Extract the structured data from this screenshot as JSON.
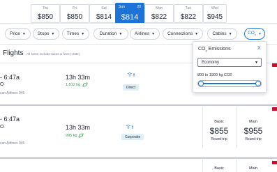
{
  "date_strip": {
    "cells": [
      {
        "dow": "Thu",
        "price": "$850"
      },
      {
        "dow": "Fri",
        "price": "$850"
      },
      {
        "dow": "Sat",
        "price": "$814"
      },
      {
        "dow": "Sun",
        "day": "20",
        "price": "$814",
        "active": true
      },
      {
        "dow": "Mon",
        "price": "$822"
      },
      {
        "dow": "Tue",
        "price": "$822"
      },
      {
        "dow": "Wed",
        "price": "$945"
      }
    ]
  },
  "filters": {
    "price": "Price",
    "stops": "Stops",
    "times": "Times",
    "duration": "Duration",
    "airlines": "Airlines",
    "connections": "Connections",
    "cabins": "Cabins",
    "co2": "CO",
    "co2_sub": "2"
  },
  "header": {
    "title": "Flights",
    "note": "All fares include taxes & fees (USD)"
  },
  "results": [
    {
      "time": "- 6:47a",
      "route": "O",
      "airline": "can Airlines 945",
      "duration": "13h 33m",
      "co2": "1,812 kg",
      "stop": "Direct"
    },
    {
      "time": "- 6:47a",
      "route": "O",
      "airline": "can Airlines 945",
      "duration": "13h 33m",
      "co2": "995 kg",
      "stop": "Corporate",
      "fares": [
        {
          "label": "Basic",
          "price": "$855",
          "sub": "Round-trip"
        },
        {
          "label": "Main",
          "price": "$955",
          "sub": "Round-trip"
        }
      ]
    },
    {
      "fares": [
        {
          "label": "Basic"
        },
        {
          "label": "Main"
        }
      ]
    }
  ],
  "co2_panel": {
    "title": "CO",
    "title_sub": "2",
    "title_rest": " Emissions",
    "close": "X",
    "cabin_value": "Economy",
    "range_label": "800 to 1900 kg CO2",
    "range_min": 800,
    "range_max": 1900
  },
  "colors": {
    "accent": "#1d73d6",
    "co2_green": "#2e9b4c",
    "red": "#c8102e"
  }
}
